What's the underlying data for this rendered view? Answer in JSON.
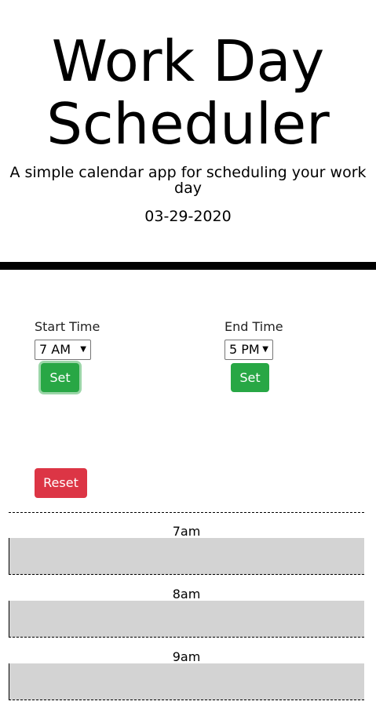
{
  "header": {
    "title_line1": "Work Day",
    "title_line2": "Scheduler",
    "subtitle": "A simple calendar app for scheduling your work day",
    "date": "03-29-2020"
  },
  "controls": {
    "start": {
      "label": "Start Time",
      "selected": "7 AM",
      "button_label": "Set"
    },
    "end": {
      "label": "End Time",
      "selected": "5 PM",
      "button_label": "Set"
    },
    "reset_label": "Reset"
  },
  "hours": [
    {
      "label": "7am",
      "text": ""
    },
    {
      "label": "8am",
      "text": ""
    },
    {
      "label": "9am",
      "text": ""
    }
  ],
  "colors": {
    "set_button": "#28a745",
    "reset_button": "#dc3545",
    "time_block": "#d3d3d3"
  }
}
